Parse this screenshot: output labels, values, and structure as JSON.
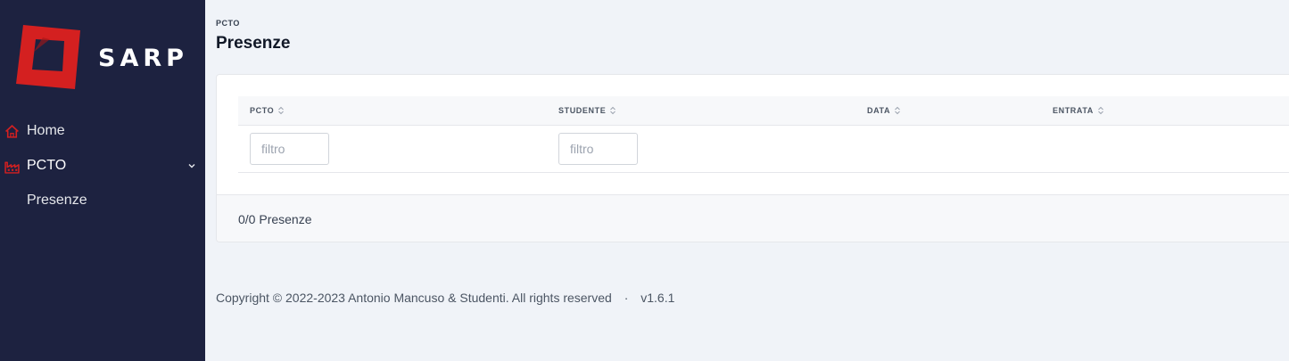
{
  "app": {
    "logo_text": "SARP",
    "brand_color": "#d42020"
  },
  "sidebar": {
    "items": [
      {
        "label": "Home",
        "icon": "home-icon"
      },
      {
        "label": "PCTO",
        "icon": "factory-icon",
        "expanded": true
      },
      {
        "label": "Presenze",
        "sub": true
      }
    ]
  },
  "header": {
    "breadcrumb": "PCTO",
    "title": "Presenze"
  },
  "table": {
    "columns": [
      "PCTO",
      "STUDENTE",
      "DATA",
      "ENTRATA"
    ],
    "filter_placeholders": [
      "filtro",
      "filtro"
    ],
    "rows": [],
    "count_text": "0/0 Presenze"
  },
  "footer": {
    "copyright": "Copyright © 2022-2023 Antonio Mancuso & Studenti. All rights reserved",
    "separator": "·",
    "version": "v1.6.1"
  }
}
